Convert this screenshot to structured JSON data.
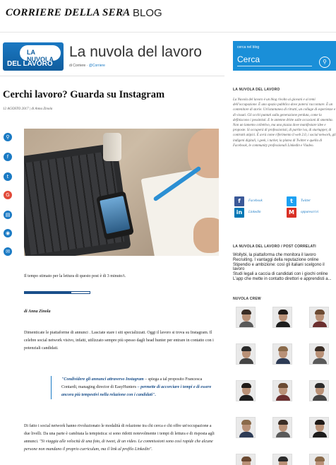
{
  "header": {
    "brand": "CORRIERE DELLA SERA",
    "separator": "/",
    "section": "BLOG"
  },
  "blog": {
    "logo_line1": "LA NUVOLA",
    "logo_line2": "DEL LAVORO",
    "title": "La nuvola del lavoro",
    "subtitle_prefix": "di Corriere",
    "subtitle_handle": "@Corriere"
  },
  "post": {
    "title": "Cerchi lavoro? Guarda su Instagram",
    "meta": "12 AGOSTO 2017 | di Anna Zinola",
    "read_time": "Il tempo stimato per la lettura di questo post è di 3 minuto/i.",
    "read_progress": 0.72,
    "author": "di Anna Zinola",
    "paragraph1": "Dimenticate le piattaforme di annunci . Lasciate stare i siti specializzati. Oggi il lavoro si trova su Instagram. Il celebre social network visivo, infatti, utilizzato sempre più spesso dagli head hunter per entrare in contatto con i potenziali candidati.",
    "quote_em": "\"Condividere gli annunci attraverso Instagram",
    "quote_mid": " – spiega a tal proposito Francesca Contardi, managing director di EasyHunters ",
    "quote_end": "– permette di accorciare i tempi e di essere ancora più tempestivi nella relazione con i candidati\".",
    "paragraph2_a": "Di fatto i social network hanno rivoluzionato le modalità di relazione tra chi cerca e chi offre un'occupazione a due livelli. Da una parte è cambiata la tempistica: si sono ridotti notevolmente i tempi di lettura e di risposta agli annunci. ",
    "paragraph2_b": "\"Si viaggia alle velocità di una foto, di tweet, di un video. Le commissioni sono così rapide che alcune persone non mandano il proprio curriculum, ma il link al profilo Linkedin\"."
  },
  "share_icons": [
    "share-icon",
    "facebook-icon",
    "twitter-icon",
    "googleplus-icon",
    "print-icon",
    "audio-icon",
    "email-icon"
  ],
  "sidebar": {
    "search_label": "cerca nel blog",
    "search_placeholder": "Cerca",
    "about_heading": "LA NUVOLA DEL LAVORO",
    "about_text": "La Nuvola del lavoro è un blog rivolto ai giovani e ai temi dell'occupazione. È uno spazio pubblico dove potersi raccontare. È un contenitore di storie. Un'istantanea di ritratti, un collage di esperienze e di vissuti. Gli occhi puntati sulla generazione perduta, come la definiscono i pessimisti. E le antenne dritte sulle occasioni di smentita. Non un lamento collettivo, ma una piazza dove manifestare idee e proposte. Si occuperà di professionisti, di partite iva, di sturtupper, di contratti atipici. È avrà come riferimento il web 2.0, i social network, gli indigeni digitali, i geek, i turker, la platea di Twitter e quella di Facebook, le community professionali Linkedin e Viadeo.",
    "social": [
      {
        "icon": "facebook-icon",
        "label": "Facebook"
      },
      {
        "icon": "twitter-icon",
        "label": "Twitter"
      },
      {
        "icon": "linkedin-icon",
        "label": "Linkedin"
      },
      {
        "icon": "email-icon",
        "label": "oppurescrivi"
      }
    ],
    "related_heading": "LA NUVOLA DEL LAVORO / POST CORRELATI",
    "related_posts": [
      "Wollybi, la piattaforma che monitora il lavoro",
      "Recruiting. I vantaggi della reputazione online",
      "Stipendio e ambizione: così gli italiani scelgono il lavoro",
      "Studi legali a caccia di candidati con i giochi online",
      "L'app che mette in contatto direttori e apprendisti a..."
    ],
    "crew_heading": "NUVOLA CREW"
  },
  "colors": {
    "accent": "#1a8fd8",
    "link": "#1a7ac4",
    "dark_blue": "#1a4f8a",
    "google_red": "#e24b3a"
  }
}
